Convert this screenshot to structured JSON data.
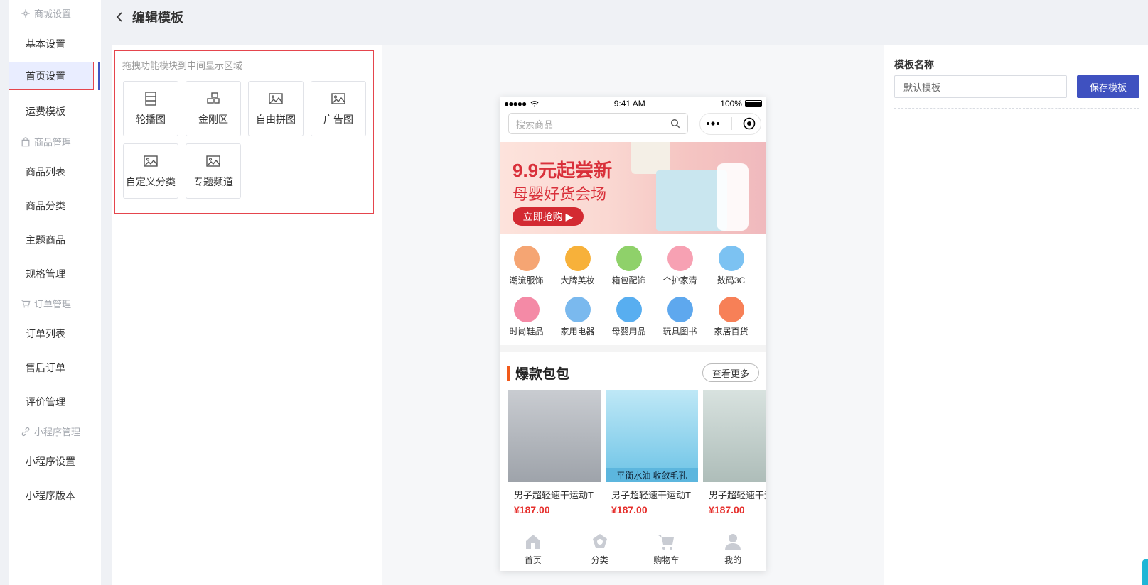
{
  "sidebar": {
    "groups": [
      {
        "label": "商城设置",
        "icon": "gear-icon",
        "items": [
          "基本设置",
          "首页设置",
          "运费模板"
        ]
      },
      {
        "label": "商品管理",
        "icon": "bag-icon",
        "items": [
          "商品列表",
          "商品分类",
          "主题商品",
          "规格管理"
        ]
      },
      {
        "label": "订单管理",
        "icon": "cart-icon",
        "items": [
          "订单列表",
          "售后订单",
          "评价管理"
        ]
      },
      {
        "label": "小程序管理",
        "icon": "link-icon",
        "items": [
          "小程序设置",
          "小程序版本"
        ]
      }
    ],
    "active_item": "首页设置"
  },
  "header": {
    "title": "编辑模板"
  },
  "modules": {
    "hint": "拖拽功能模块到中间显示区域",
    "items": [
      {
        "label": "轮播图",
        "icon": "carousel-icon"
      },
      {
        "label": "金刚区",
        "icon": "blocks-icon"
      },
      {
        "label": "自由拼图",
        "icon": "image-icon"
      },
      {
        "label": "广告图",
        "icon": "image-icon"
      },
      {
        "label": "自定义分类",
        "icon": "image-icon"
      },
      {
        "label": "专题频道",
        "icon": "image-icon"
      }
    ]
  },
  "phone": {
    "status": {
      "time": "9:41 AM",
      "battery": "100%"
    },
    "search_placeholder": "搜索商品",
    "banner": {
      "title": "9.9元起尝新",
      "subtitle": "母婴好货会场",
      "button": "立即抢购"
    },
    "categories": [
      {
        "label": "潮流服饰",
        "color": "#f5a573"
      },
      {
        "label": "大牌美妆",
        "color": "#f7b13a"
      },
      {
        "label": "箱包配饰",
        "color": "#8fd16a"
      },
      {
        "label": "个护家清",
        "color": "#f7a1b3"
      },
      {
        "label": "数码3C",
        "color": "#7cc2f2"
      },
      {
        "label": "时尚鞋品",
        "color": "#f48aa6"
      },
      {
        "label": "家用电器",
        "color": "#7ab9ee"
      },
      {
        "label": "母婴用品",
        "color": "#58aef0"
      },
      {
        "label": "玩具图书",
        "color": "#5ea8ee"
      },
      {
        "label": "家居百货",
        "color": "#f78057"
      }
    ],
    "hot": {
      "title": "爆款包包",
      "more": "查看更多",
      "products": [
        {
          "name": "男子超轻速干运动T",
          "price": "¥187.00",
          "color": "#b8bcc2"
        },
        {
          "name": "男子超轻速干运动T",
          "price": "¥187.00",
          "color": "#8fd4ee",
          "caption": "平衡水油 收敛毛孔"
        },
        {
          "name": "男子超轻速干运动T",
          "price": "¥187.00",
          "color": "#c6d3d0"
        }
      ]
    },
    "tabs": [
      "首页",
      "分类",
      "购物车",
      "我的"
    ]
  },
  "settings": {
    "name_label": "模板名称",
    "name_value": "默认模板",
    "save_label": "保存模板"
  },
  "colors": {
    "accent": "#3f51c0",
    "highlight": "#e5454d",
    "price": "#e6302d"
  }
}
